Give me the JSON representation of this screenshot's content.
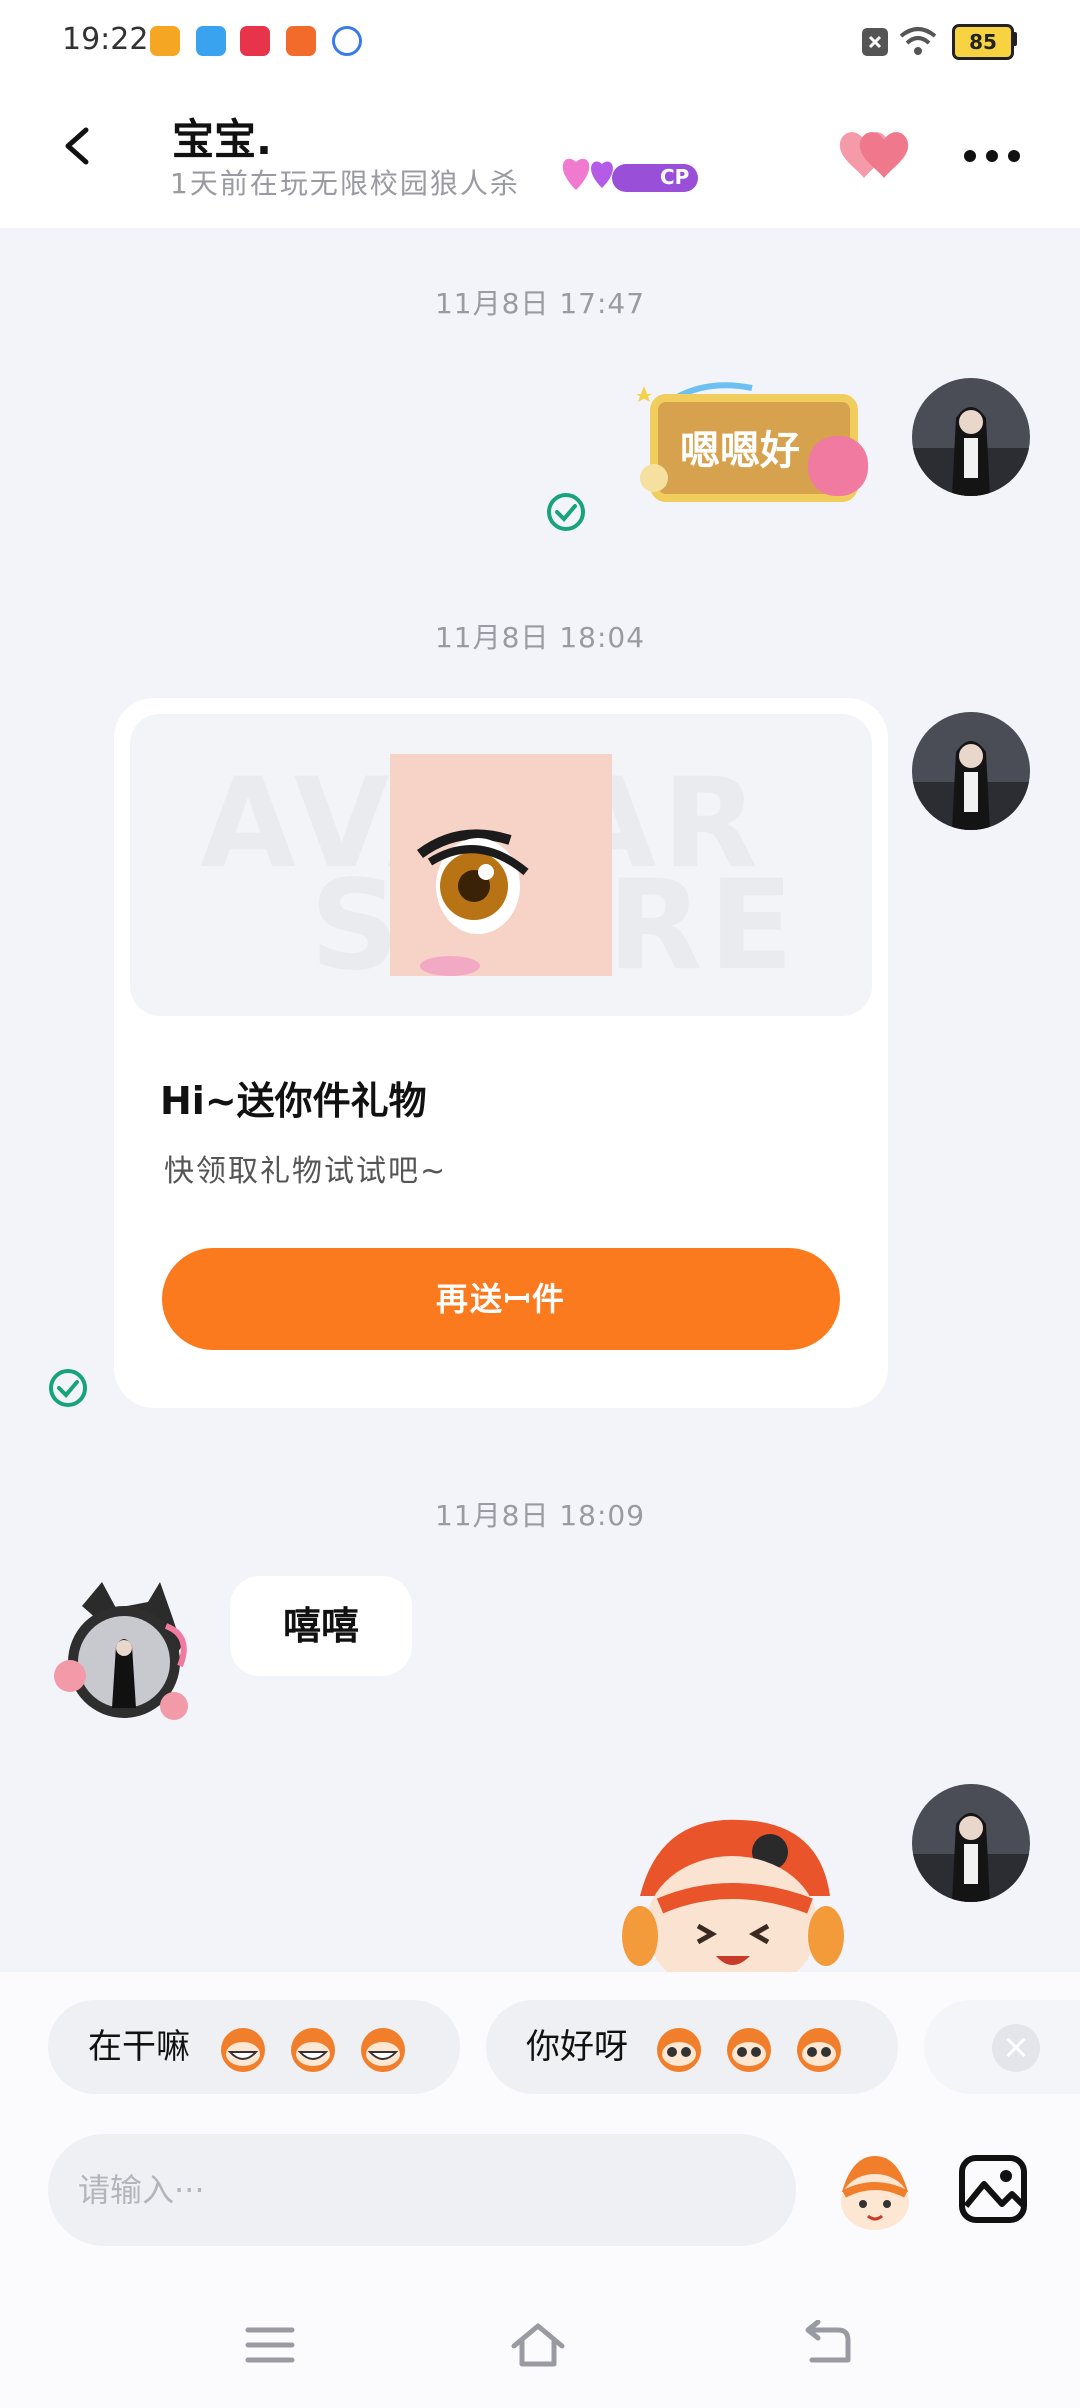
{
  "status_bar": {
    "time": "19:22",
    "battery": "85"
  },
  "header": {
    "title": "宝宝.",
    "subtitle": "1天前在玩无限校园狼人杀",
    "cp_badge": "CP"
  },
  "messages": {
    "ts1": "11月8日  17:47",
    "sticker1_text": "嗯嗯好",
    "ts2": "11月8日  18:04",
    "gift_watermark_top": "AVATAR",
    "gift_watermark_bottom": "STORE",
    "gift_title": "Hi~送你件礼物",
    "gift_desc": "快领取礼物试试吧~",
    "gift_button": "再送ꟷ件",
    "ts3": "11月8日  18:09",
    "received_text": "嘻嘻"
  },
  "quick_replies": [
    {
      "label": "在干嘛"
    },
    {
      "label": "你好呀"
    }
  ],
  "input": {
    "placeholder": "请输入···"
  },
  "colors": {
    "accent": "#fb7a1e",
    "check": "#17a37c",
    "background": "#f3f4f9"
  }
}
